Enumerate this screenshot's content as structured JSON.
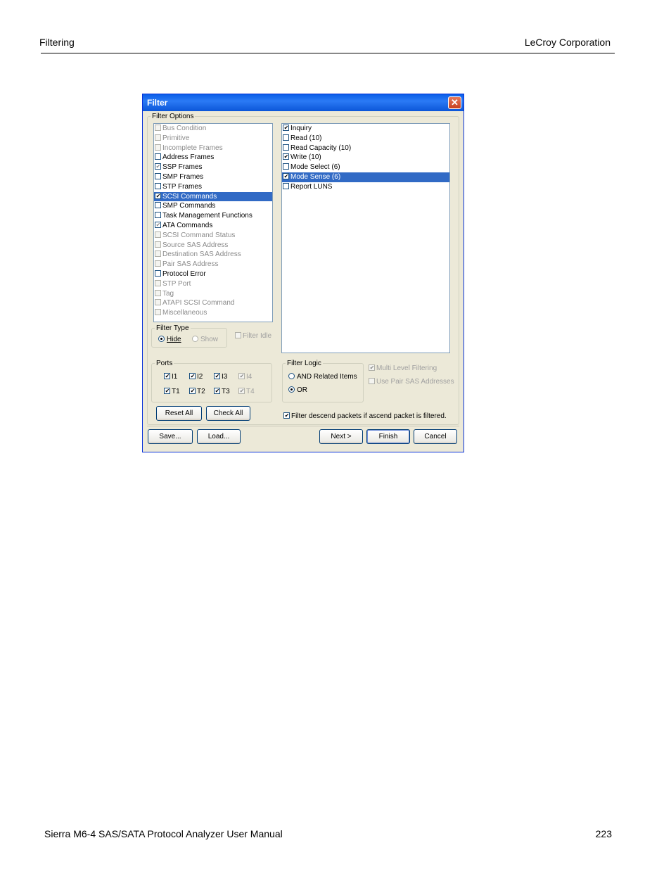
{
  "page": {
    "header_left": "Filtering",
    "header_right": "LeCroy Corporation",
    "footer_left": "Sierra M6-4 SAS/SATA Protocol Analyzer User Manual",
    "footer_right": "223"
  },
  "dialog": {
    "title": "Filter",
    "close_glyph": "✕",
    "filter_options_label": "Filter Options",
    "options_list": [
      {
        "label": "Bus Condition",
        "checked": false,
        "disabled": true
      },
      {
        "label": "Primitive",
        "checked": false,
        "disabled": true
      },
      {
        "label": "Incomplete Frames",
        "checked": false,
        "disabled": true
      },
      {
        "label": "Address Frames",
        "checked": false,
        "disabled": false
      },
      {
        "label": "SSP Frames",
        "checked": true,
        "disabled": false
      },
      {
        "label": "SMP Frames",
        "checked": false,
        "disabled": false
      },
      {
        "label": "STP Frames",
        "checked": false,
        "disabled": false
      },
      {
        "label": "SCSI Commands",
        "checked": true,
        "disabled": false,
        "selected": true
      },
      {
        "label": "SMP Commands",
        "checked": false,
        "disabled": false
      },
      {
        "label": "Task Management Functions",
        "checked": false,
        "disabled": false
      },
      {
        "label": "ATA Commands",
        "checked": true,
        "disabled": false
      },
      {
        "label": "SCSI Command Status",
        "checked": false,
        "disabled": true
      },
      {
        "label": "Source SAS Address",
        "checked": false,
        "disabled": true
      },
      {
        "label": "Destination SAS Address",
        "checked": false,
        "disabled": true
      },
      {
        "label": "Pair SAS Address",
        "checked": false,
        "disabled": true
      },
      {
        "label": "Protocol Error",
        "checked": false,
        "disabled": false
      },
      {
        "label": "STP Port",
        "checked": false,
        "disabled": true
      },
      {
        "label": "Tag",
        "checked": false,
        "disabled": true
      },
      {
        "label": "ATAPI SCSI Command",
        "checked": false,
        "disabled": true
      },
      {
        "label": "Miscellaneous",
        "checked": false,
        "disabled": true
      }
    ],
    "commands_list": [
      {
        "label": "Inquiry",
        "checked": true
      },
      {
        "label": "Read (10)",
        "checked": false
      },
      {
        "label": "Read Capacity (10)",
        "checked": false
      },
      {
        "label": "Write (10)",
        "checked": true
      },
      {
        "label": "Mode Select (6)",
        "checked": false
      },
      {
        "label": "Mode Sense (6)",
        "checked": true,
        "selected": true
      },
      {
        "label": "Report LUNS",
        "checked": false
      }
    ],
    "filter_type": {
      "label": "Filter Type",
      "hide": "Hide",
      "show": "Show",
      "selected": "hide",
      "filter_idle": "Filter Idle"
    },
    "ports": {
      "label": "Ports",
      "row1": [
        {
          "label": "I1",
          "checked": true,
          "disabled": false
        },
        {
          "label": "I2",
          "checked": true,
          "disabled": false
        },
        {
          "label": "I3",
          "checked": true,
          "disabled": false
        },
        {
          "label": "I4",
          "checked": true,
          "disabled": true
        }
      ],
      "row2": [
        {
          "label": "T1",
          "checked": true,
          "disabled": false
        },
        {
          "label": "T2",
          "checked": true,
          "disabled": false
        },
        {
          "label": "T3",
          "checked": true,
          "disabled": false
        },
        {
          "label": "T4",
          "checked": true,
          "disabled": true
        }
      ]
    },
    "filter_logic": {
      "label": "Filter Logic",
      "and_option": "AND Related Items",
      "or_option": "OR",
      "selected": "or"
    },
    "multi_level_filtering": "Multi Level Filtering",
    "use_pair_sas": "Use Pair SAS Addresses",
    "filter_descend": "Filter descend packets if ascend packet is filtered.",
    "buttons": {
      "reset_all": "Reset All",
      "check_all": "Check All",
      "save": "Save...",
      "load": "Load...",
      "next": "Next >",
      "finish": "Finish",
      "cancel": "Cancel"
    }
  }
}
